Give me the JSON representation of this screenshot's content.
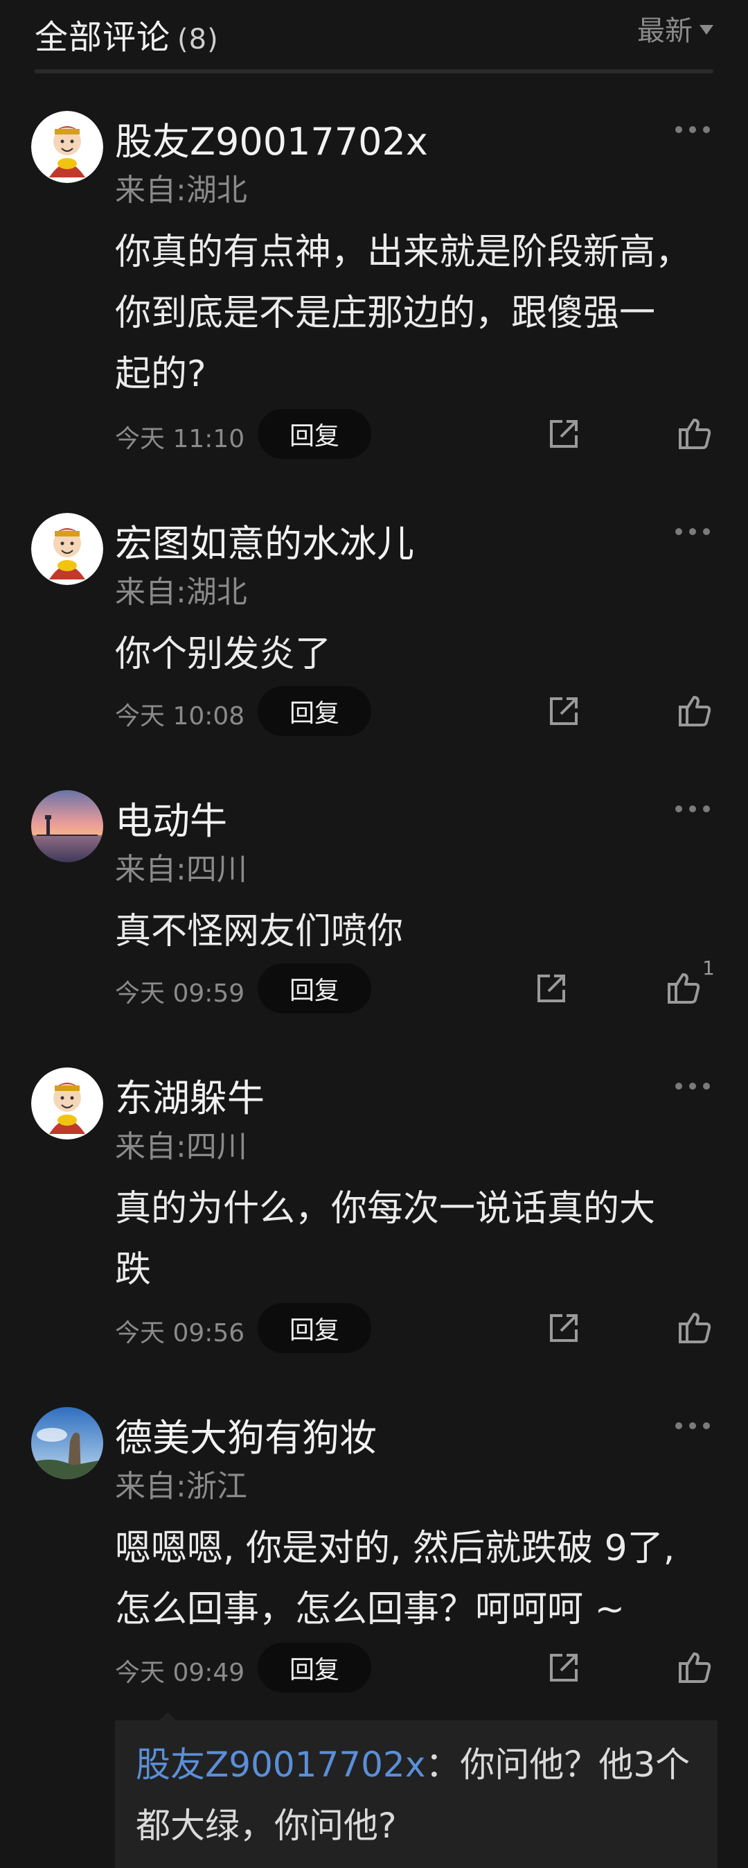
{
  "header": {
    "title": "全部评论",
    "count": "(8)",
    "sort_label": "最新"
  },
  "comments": [
    {
      "username": "股友Z90017702x",
      "location": "来自:湖北",
      "text": "你真的有点神，出来就是阶段新高，\n你到底是不是庄那边的，跟傻强一\n起的?",
      "time": "今天 11:10",
      "reply_label": "回复",
      "likes": "",
      "avatar": "caishen-avatar"
    },
    {
      "username": "宏图如意的水冰儿",
      "location": "来自:湖北",
      "text": "你个别发炎了",
      "time": "今天 10:08",
      "reply_label": "回复",
      "likes": "",
      "avatar": "caishen-avatar"
    },
    {
      "username": "电动牛",
      "location": "来自:四川",
      "text": "真不怪网友们喷你",
      "time": "今天 09:59",
      "reply_label": "回复",
      "likes": "1",
      "avatar": "sunset-avatar"
    },
    {
      "username": "东湖躲牛",
      "location": "来自:四川",
      "text": "真的为什么，你每次一说话真的大\n跌",
      "time": "今天 09:56",
      "reply_label": "回复",
      "likes": "",
      "avatar": "caishen-avatar"
    },
    {
      "username": "德美大狗有狗妆",
      "location": "来自:浙江",
      "text": "嗯嗯嗯, 你是对的, 然后就跌破 9了,\n怎么回事，怎么回事？呵呵呵 ~",
      "time": "今天 09:49",
      "reply_label": "回复",
      "likes": "",
      "avatar": "landscape-avatar"
    }
  ],
  "sub_reply": {
    "user": "股友Z90017702x",
    "separator": "：",
    "text": "你问他？他3个都大绿，你问他?"
  },
  "colors": {
    "background": "#161616",
    "link": "#5b8fd8",
    "button_bg": "#0c0c0c",
    "muted": "#8a8a8a"
  }
}
